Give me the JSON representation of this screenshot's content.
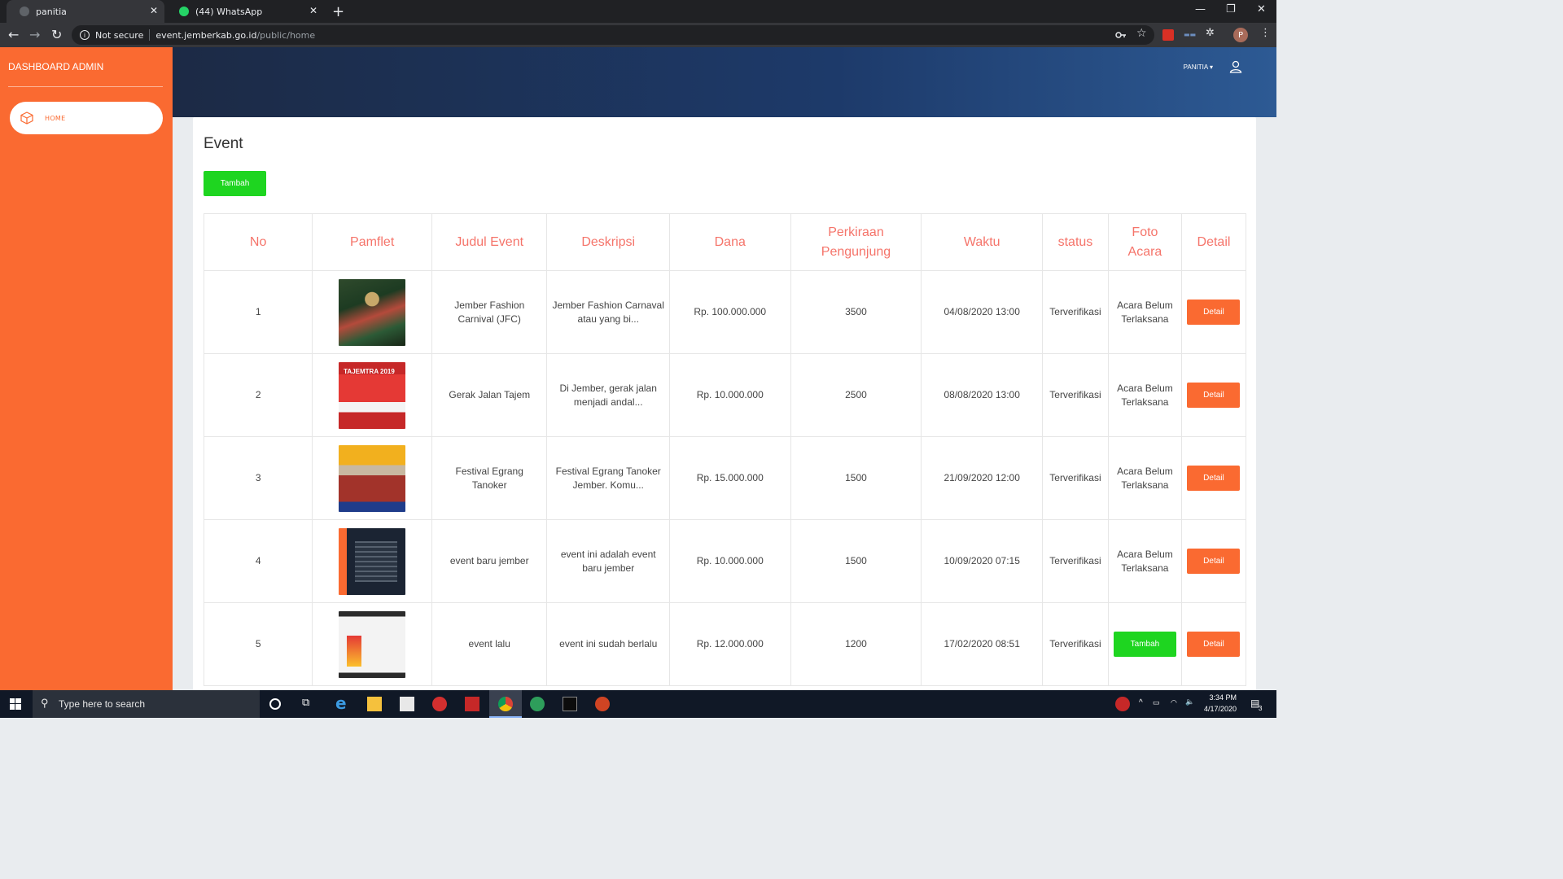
{
  "browser": {
    "tabs": [
      {
        "title": "panitia",
        "active": true
      },
      {
        "title": "(44) WhatsApp",
        "active": false
      }
    ],
    "security_label": "Not secure",
    "url_host": "event.jemberkab.go.id",
    "url_path": "/public/home",
    "profile_initial": "P"
  },
  "sidebar": {
    "brand": "DASHBOARD ADMIN",
    "items": [
      {
        "label": "HOME",
        "icon": "cube-icon"
      }
    ]
  },
  "header": {
    "user_menu": "PANITIA"
  },
  "main": {
    "title": "Event",
    "add_button": "Tambah",
    "columns": [
      "No",
      "Pamflet",
      "Judul Event",
      "Deskripsi",
      "Dana",
      "Perkiraan Pengunjung",
      "Waktu",
      "status",
      "Foto Acara",
      "Detail"
    ],
    "rows": [
      {
        "no": "1",
        "judul": "Jember Fashion Carnival (JFC)",
        "deskripsi": "Jember Fashion Carnaval atau yang bi...",
        "dana": "Rp. 100.000.000",
        "pengunjung": "3500",
        "waktu": "04/08/2020 13:00",
        "status": "Terverifikasi",
        "foto": "Acara Belum Terlaksana",
        "detail": "Detail"
      },
      {
        "no": "2",
        "judul": "Gerak Jalan Tajem",
        "deskripsi": "Di Jember, gerak jalan menjadi andal...",
        "dana": "Rp. 10.000.000",
        "pengunjung": "2500",
        "waktu": "08/08/2020 13:00",
        "status": "Terverifikasi",
        "foto": "Acara Belum Terlaksana",
        "detail": "Detail"
      },
      {
        "no": "3",
        "judul": "Festival Egrang Tanoker",
        "deskripsi": "Festival Egrang Tanoker Jember. Komu...",
        "dana": "Rp. 15.000.000",
        "pengunjung": "1500",
        "waktu": "21/09/2020 12:00",
        "status": "Terverifikasi",
        "foto": "Acara Belum Terlaksana",
        "detail": "Detail"
      },
      {
        "no": "4",
        "judul": "event baru jember",
        "deskripsi": "event ini adalah event baru jember",
        "dana": "Rp. 10.000.000",
        "pengunjung": "1500",
        "waktu": "10/09/2020 07:15",
        "status": "Terverifikasi",
        "foto": "Acara Belum Terlaksana",
        "detail": "Detail"
      },
      {
        "no": "5",
        "judul": "event lalu",
        "deskripsi": "event ini sudah berlalu",
        "dana": "Rp. 12.000.000",
        "pengunjung": "1200",
        "waktu": "17/02/2020 08:51",
        "status": "Terverifikasi",
        "foto_button": "Tambah",
        "detail": "Detail"
      }
    ],
    "pamflet_texts": {
      "row2": "TAJEMTRA 2019"
    }
  },
  "taskbar": {
    "search_placeholder": "Type here to search",
    "time": "3:34 PM",
    "date": "4/17/2020",
    "notifications": "3"
  },
  "colors": {
    "sidebar": "#fa6a31",
    "header_accent": "#f5746a",
    "green": "#1ed520",
    "detail_button": "#fa6a31"
  }
}
